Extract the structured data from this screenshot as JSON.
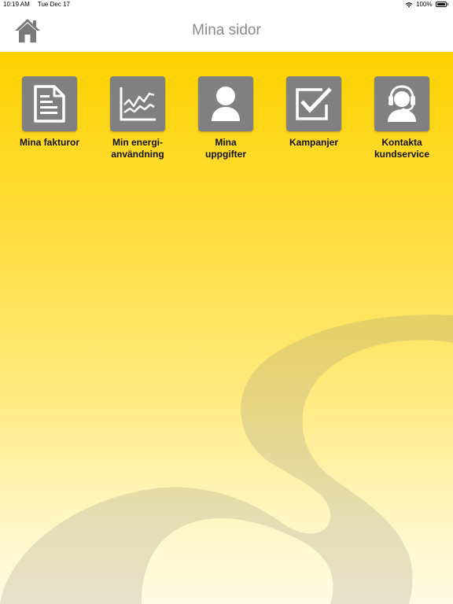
{
  "status": {
    "time": "10:19 AM",
    "date": "Tue Dec 17",
    "battery": "100%"
  },
  "header": {
    "title": "Mina sidor"
  },
  "tiles": [
    {
      "label": "Mina fakturor",
      "icon": "invoice-icon"
    },
    {
      "label": "Min energi-\nanvändning",
      "icon": "chart-icon"
    },
    {
      "label": "Mina\nuppgifter",
      "icon": "user-icon"
    },
    {
      "label": "Kampanjer",
      "icon": "checkbox-icon"
    },
    {
      "label": "Kontakta\nkundservice",
      "icon": "headset-icon"
    }
  ],
  "colors": {
    "accent": "#ffd200",
    "tile": "#808080",
    "title": "#8a8a8a"
  }
}
